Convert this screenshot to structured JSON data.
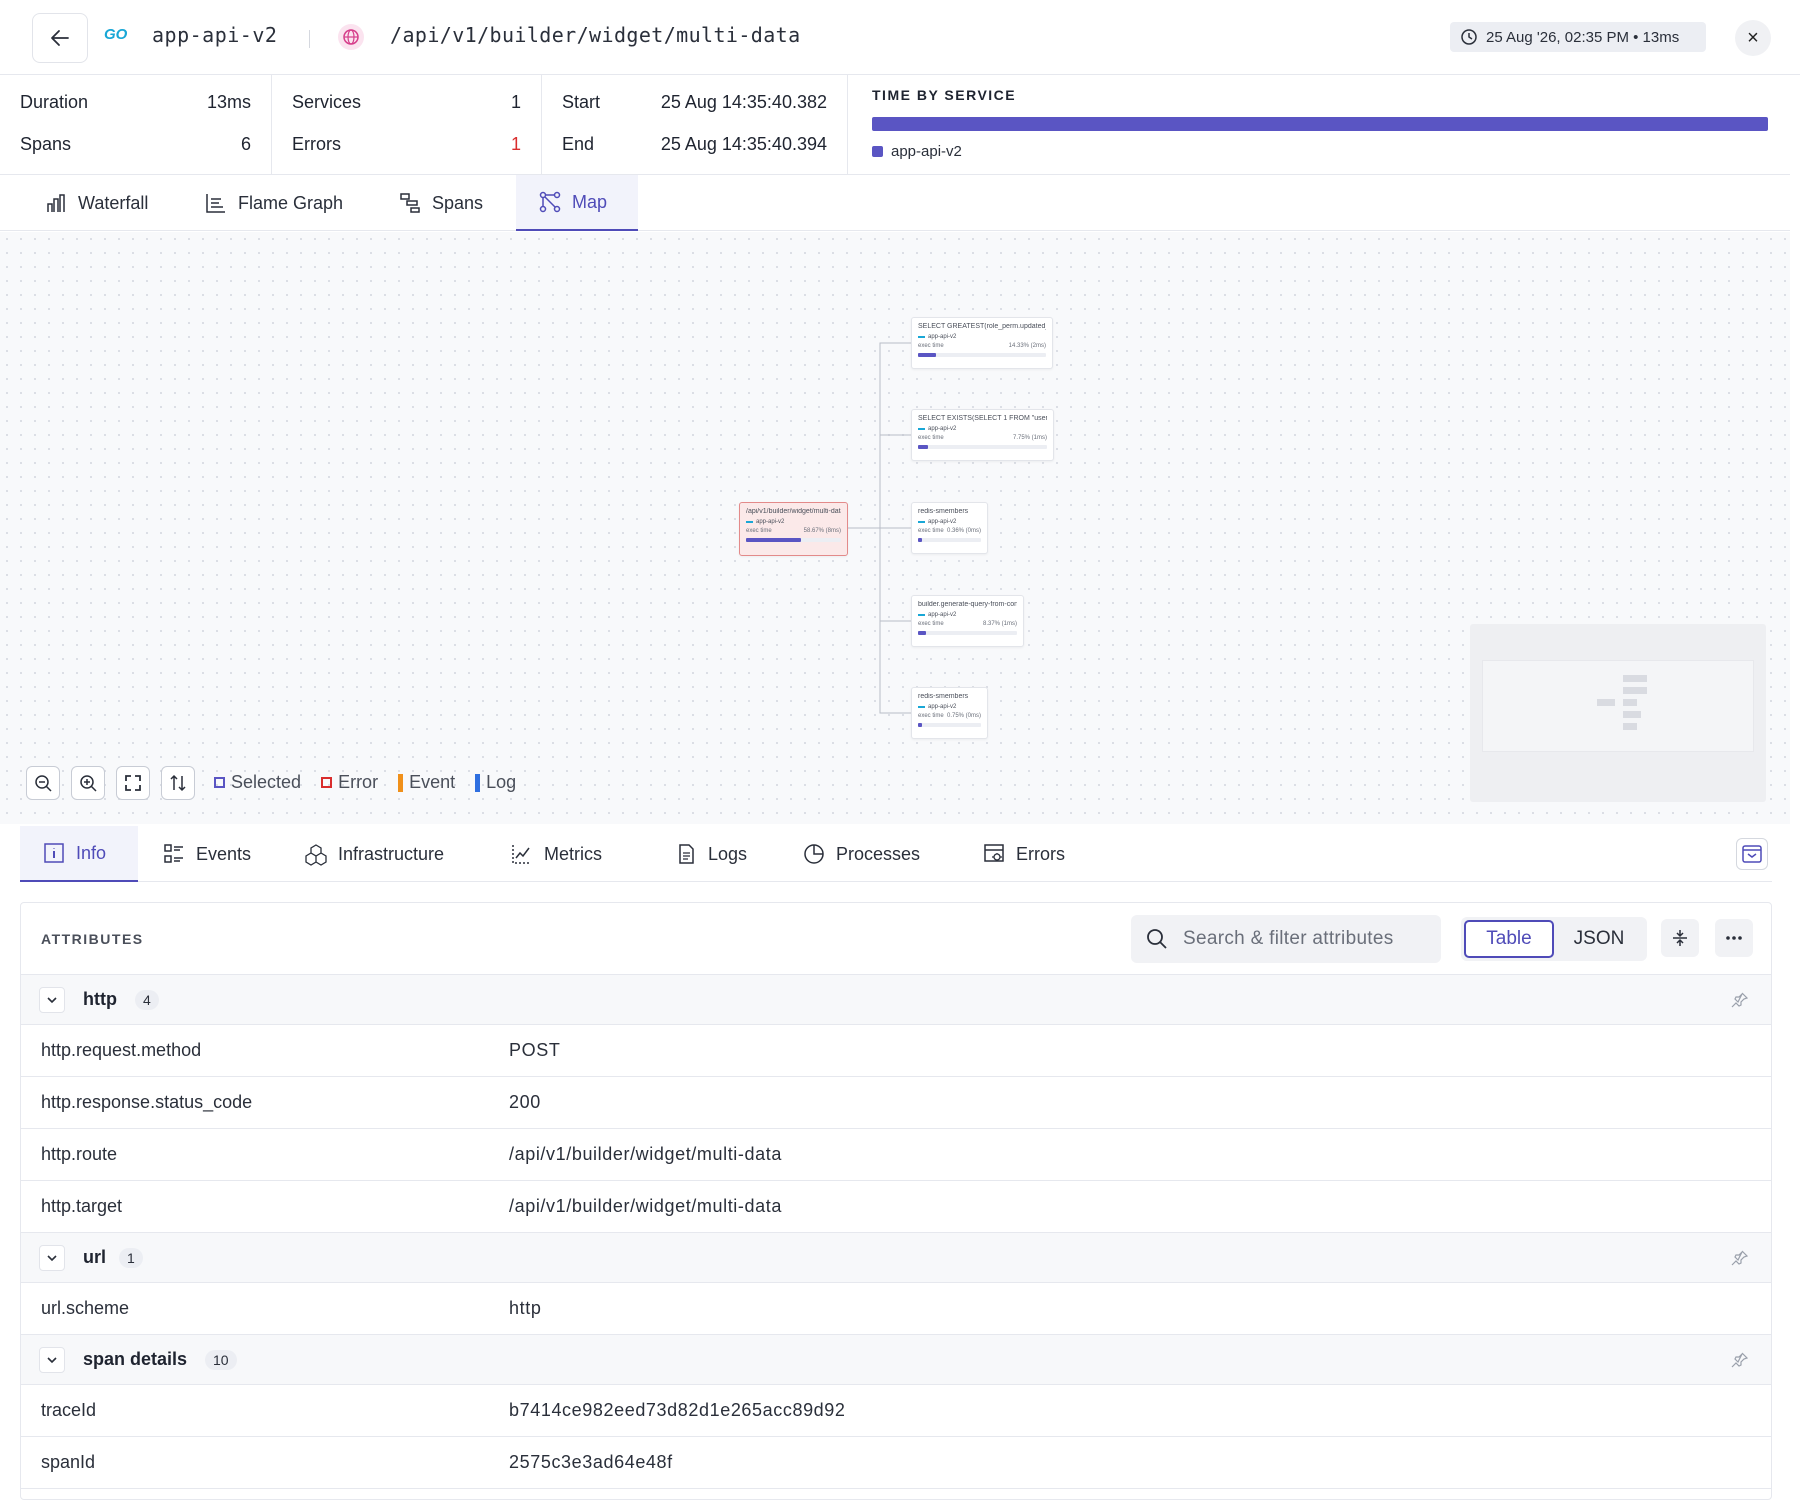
{
  "header": {
    "lang_badge": "GO",
    "service_name": "app-api-v2",
    "route": "/api/v1/builder/widget/multi-data",
    "timestamp": "25 Aug '26, 02:35 PM • 13ms",
    "close_label": "×"
  },
  "stats": {
    "duration_label": "Duration",
    "duration_value": "13ms",
    "spans_label": "Spans",
    "spans_value": "6",
    "services_label": "Services",
    "services_value": "1",
    "errors_label": "Errors",
    "errors_value": "1",
    "start_label": "Start",
    "start_value": "25 Aug 14:35:40.382",
    "end_label": "End",
    "end_value": "25 Aug 14:35:40.394"
  },
  "time_by_service": {
    "title": "TIME BY SERVICE",
    "legend": "app-api-v2",
    "color": "#5a55c3"
  },
  "view_tabs": [
    {
      "label": "Waterfall",
      "icon": "waterfall-icon"
    },
    {
      "label": "Flame Graph",
      "icon": "flame-graph-icon"
    },
    {
      "label": "Spans",
      "icon": "spans-icon"
    },
    {
      "label": "Map",
      "icon": "map-icon",
      "active": true
    }
  ],
  "map": {
    "nodes": [
      {
        "title": "/api/v1/builder/widget/multi-data",
        "service": "app-api-v2",
        "time_label": "exec time",
        "time_value": "58.67% (8ms)",
        "fill": 0.58
      },
      {
        "title": "SELECT GREATEST(role_perm.updated_at, p...",
        "service": "app-api-v2",
        "time_label": "exec time",
        "time_value": "14.33% (2ms)",
        "fill": 0.14
      },
      {
        "title": "SELECT EXISTS(SELECT 1 FROM \"user\" WHER...",
        "service": "app-api-v2",
        "time_label": "exec time",
        "time_value": "7.75% (1ms)",
        "fill": 0.08
      },
      {
        "title": "redis-smembers",
        "service": "app-api-v2",
        "time_label": "exec time",
        "time_value": "0.36% (0ms)",
        "fill": 0.04
      },
      {
        "title": "builder.generate-query-from-config",
        "service": "app-api-v2",
        "time_label": "exec time",
        "time_value": "8.37% (1ms)",
        "fill": 0.08
      },
      {
        "title": "redis-smembers",
        "service": "app-api-v2",
        "time_label": "exec time",
        "time_value": "0.75% (0ms)",
        "fill": 0.04
      }
    ],
    "legend": {
      "selected": "Selected",
      "error": "Error",
      "event": "Event",
      "log": "Log",
      "selected_color": "#5a55c3",
      "error_color": "#d92d2d",
      "event_color": "#f0901a",
      "log_color": "#2f6fe0"
    }
  },
  "detail_tabs": [
    {
      "label": "Info",
      "icon": "info-icon",
      "active": true
    },
    {
      "label": "Events",
      "icon": "events-icon"
    },
    {
      "label": "Infrastructure",
      "icon": "infrastructure-icon"
    },
    {
      "label": "Metrics",
      "icon": "metrics-icon"
    },
    {
      "label": "Logs",
      "icon": "logs-icon"
    },
    {
      "label": "Processes",
      "icon": "processes-icon"
    },
    {
      "label": "Errors",
      "icon": "errors-icon"
    }
  ],
  "attributes": {
    "title": "ATTRIBUTES",
    "search_placeholder": "Search & filter attributes",
    "view_table": "Table",
    "view_json": "JSON",
    "groups": [
      {
        "name": "http",
        "count": "4",
        "rows": [
          {
            "key": "http.request.method",
            "value": "POST"
          },
          {
            "key": "http.response.status_code",
            "value": "200"
          },
          {
            "key": "http.route",
            "value": "/api/v1/builder/widget/multi-data"
          },
          {
            "key": "http.target",
            "value": "/api/v1/builder/widget/multi-data"
          }
        ]
      },
      {
        "name": "url",
        "count": "1",
        "rows": [
          {
            "key": "url.scheme",
            "value": "http"
          }
        ]
      },
      {
        "name": "span details",
        "count": "10",
        "rows": [
          {
            "key": "traceId",
            "value": "b7414ce982eed73d82d1e265acc89d92"
          },
          {
            "key": "spanId",
            "value": "2575c3e3ad64e48f"
          }
        ]
      }
    ]
  }
}
